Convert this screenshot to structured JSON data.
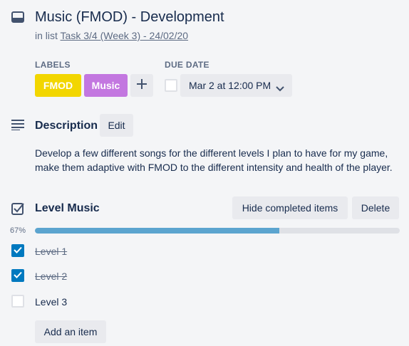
{
  "header": {
    "title": "Music (FMOD) - Development",
    "in_list_prefix": "in list",
    "list_name": "Task 3/4 (Week 3) - 24/02/20"
  },
  "labels": {
    "heading": "Labels",
    "items": [
      {
        "text": "FMOD",
        "color": "#f2d600"
      },
      {
        "text": "Music",
        "color": "#c377e0"
      }
    ],
    "add_icon": "plus-icon"
  },
  "due_date": {
    "heading": "Due Date",
    "value": "Mar 2 at 12:00 PM",
    "complete": false,
    "dropdown_icon": "chevron-down-icon"
  },
  "description": {
    "heading": "Description",
    "edit_label": "Edit",
    "text": "Develop a few different songs for the different levels I plan to have for my game, make them adaptive with FMOD to the different intensity and health of the player."
  },
  "checklist": {
    "title": "Level Music",
    "hide_completed_label": "Hide completed items",
    "delete_label": "Delete",
    "progress_text": "67%",
    "progress_fraction": 0.67,
    "items": [
      {
        "text": "Level 1",
        "checked": true
      },
      {
        "text": "Level 2",
        "checked": true
      },
      {
        "text": "Level 3",
        "checked": false
      }
    ],
    "add_item_label": "Add an item"
  },
  "colors": {
    "accent": "#0079bf",
    "progress": "#5ba4cf",
    "button_bg": "#e9eaee",
    "background": "#f4f5f7"
  }
}
